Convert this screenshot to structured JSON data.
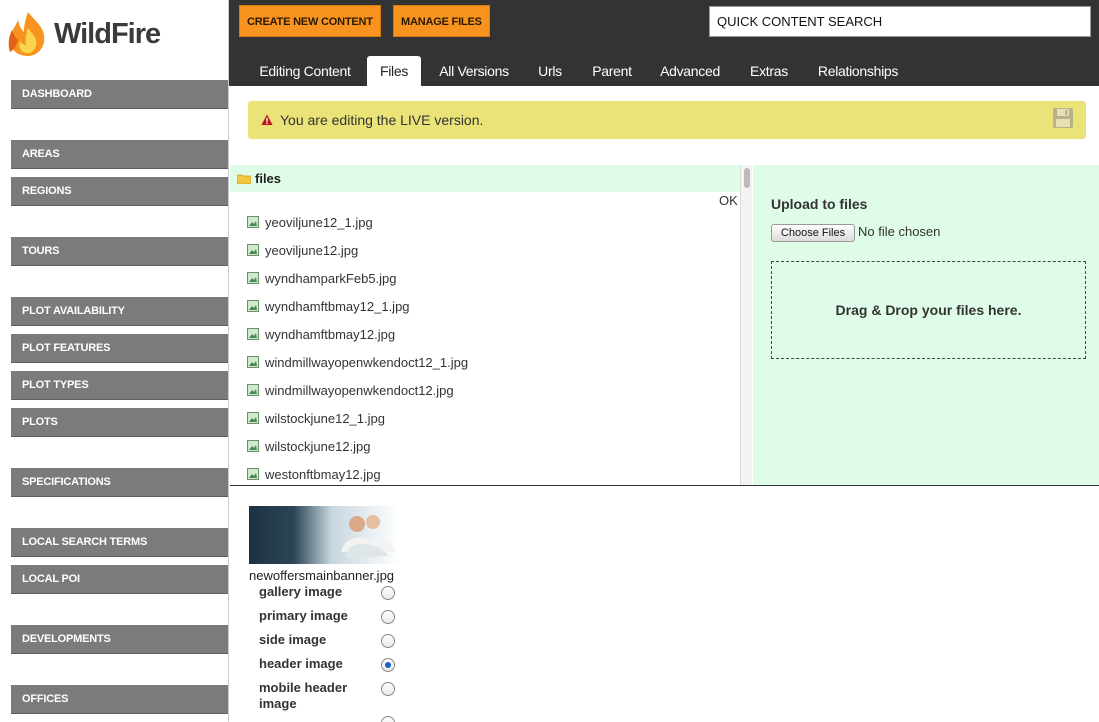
{
  "app": {
    "name": "WildFire"
  },
  "sidebar": {
    "items": [
      {
        "label": "DASHBOARD"
      },
      {
        "label": "AREAS"
      },
      {
        "label": "REGIONS"
      },
      {
        "label": "TOURS"
      },
      {
        "label": "PLOT AVAILABILITY"
      },
      {
        "label": "PLOT FEATURES"
      },
      {
        "label": "PLOT TYPES"
      },
      {
        "label": "PLOTS"
      },
      {
        "label": "SPECIFICATIONS"
      },
      {
        "label": "LOCAL SEARCH TERMS"
      },
      {
        "label": "LOCAL POI"
      },
      {
        "label": "DEVELOPMENTS"
      },
      {
        "label": "OFFICES"
      }
    ]
  },
  "toolbar": {
    "create_label": "CREATE NEW CONTENT",
    "manage_label": "MANAGE FILES",
    "search_value": "QUICK CONTENT SEARCH"
  },
  "tabs": [
    {
      "label": "Editing Content",
      "active": false
    },
    {
      "label": "Files",
      "active": true
    },
    {
      "label": "All Versions",
      "active": false
    },
    {
      "label": "Urls",
      "active": false
    },
    {
      "label": "Parent",
      "active": false
    },
    {
      "label": "Advanced",
      "active": false
    },
    {
      "label": "Extras",
      "active": false
    },
    {
      "label": "Relationships",
      "active": false
    }
  ],
  "alert": {
    "message": "You are editing the LIVE version."
  },
  "browser": {
    "folder": "files",
    "ok_label": "OK",
    "files": [
      "yeoviljune12_1.jpg",
      "yeoviljune12.jpg",
      "wyndhamparkFeb5.jpg",
      "wyndhamftbmay12_1.jpg",
      "wyndhamftbmay12.jpg",
      "windmillwayopenwkendoct12_1.jpg",
      "windmillwayopenwkendoct12.jpg",
      "wilstockjune12_1.jpg",
      "wilstockjune12.jpg",
      "westonftbmay12.jpg"
    ]
  },
  "upload": {
    "title": "Upload to files",
    "choose_label": "Choose Files",
    "no_file": "No file chosen",
    "drop_text": "Drag & Drop your files here."
  },
  "selected": {
    "filename": "newoffersmainbanner.jpg",
    "options": [
      {
        "label": "gallery image",
        "checked": false
      },
      {
        "label": "primary image",
        "checked": false
      },
      {
        "label": "side image",
        "checked": false
      },
      {
        "label": "header image",
        "checked": true
      },
      {
        "label": "mobile header image",
        "checked": false
      }
    ]
  },
  "colors": {
    "accent": "#f7931e",
    "nav": "#7b7b7b",
    "topbar": "#333333",
    "panel": "#dffce9",
    "alert": "#eae377"
  }
}
